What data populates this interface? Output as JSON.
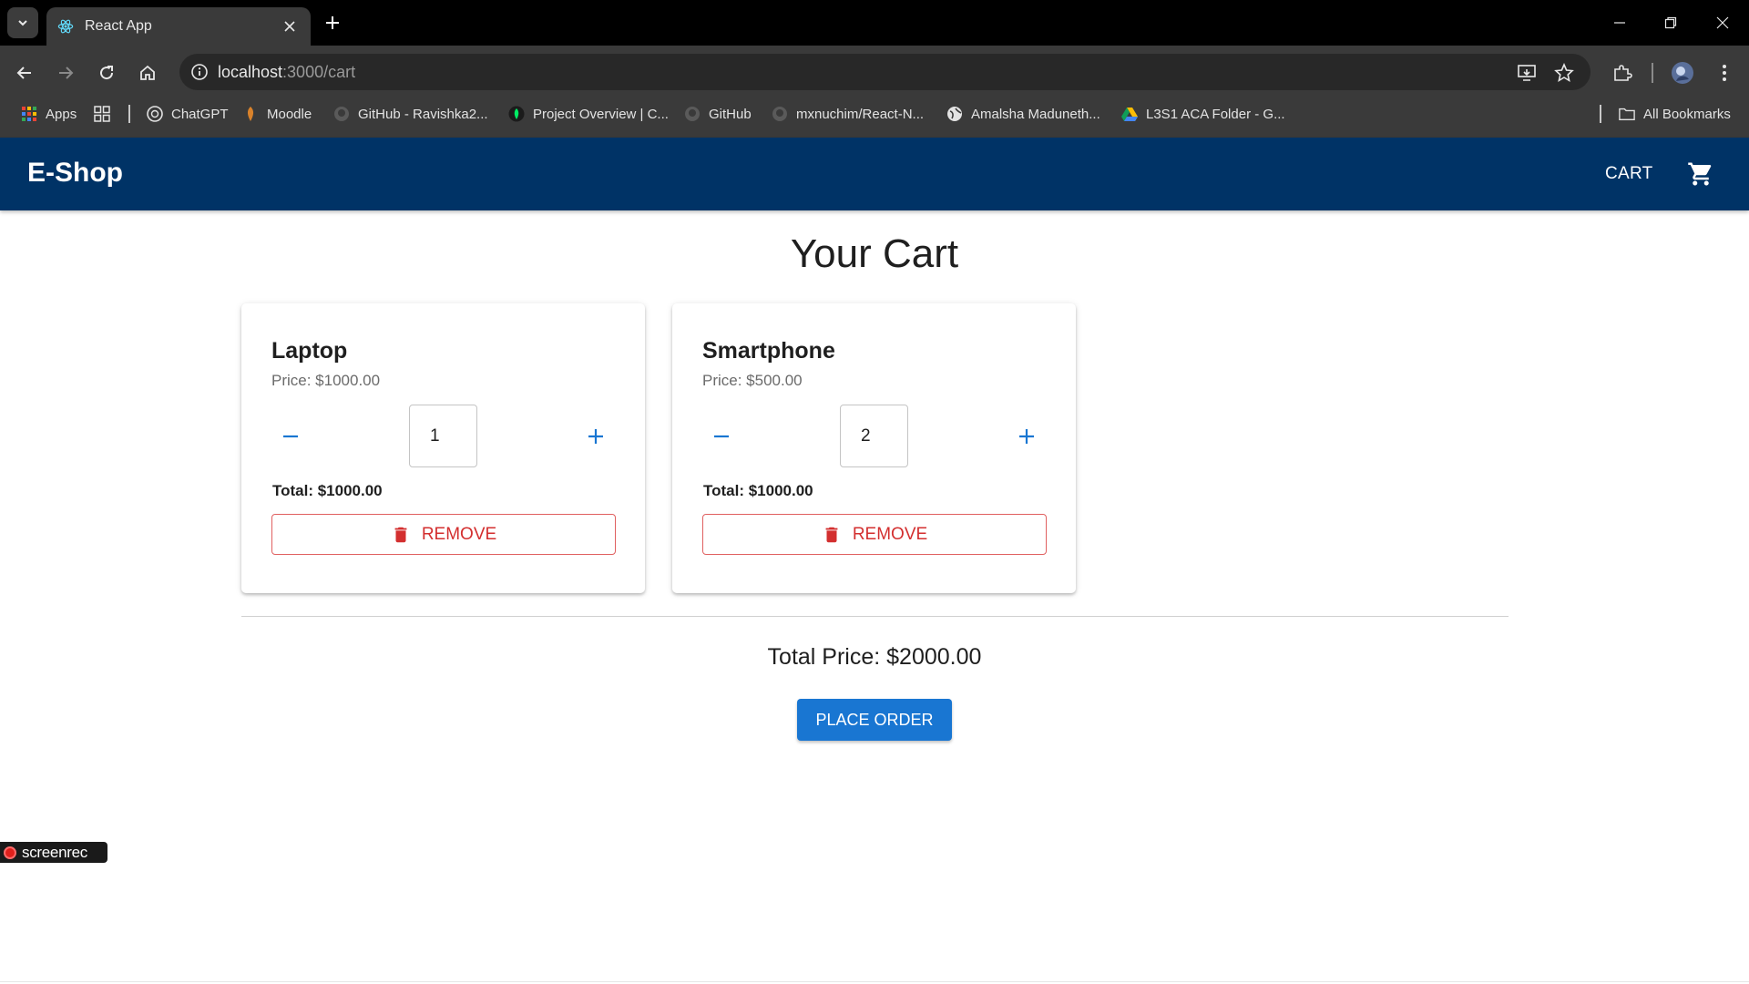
{
  "browser": {
    "tab_title": "React App",
    "url_host": "localhost",
    "url_path": ":3000/cart",
    "bookmarks": [
      {
        "label": "Apps",
        "icon": "apps-grid-icon"
      },
      {
        "label": "ChatGPT",
        "icon": "chatgpt-icon"
      },
      {
        "label": "Moodle",
        "icon": "moodle-icon"
      },
      {
        "label": "GitHub - Ravishka2...",
        "icon": "github-icon"
      },
      {
        "label": "Project Overview | C...",
        "icon": "mongodb-leaf-icon"
      },
      {
        "label": "GitHub",
        "icon": "github-icon"
      },
      {
        "label": "mxnuchim/React-N...",
        "icon": "github-icon"
      },
      {
        "label": "Amalsha Maduneth...",
        "icon": "globe-icon"
      },
      {
        "label": "L3S1 ACA Folder - G...",
        "icon": "google-drive-icon"
      }
    ],
    "all_bookmarks": "All Bookmarks"
  },
  "app": {
    "brand": "E-Shop",
    "cart_label": "CART",
    "page_title": "Your Cart",
    "items": [
      {
        "name": "Laptop",
        "price": "Price: $1000.00",
        "quantity": "1",
        "total": "Total: $1000.00",
        "remove_label": "REMOVE"
      },
      {
        "name": "Smartphone",
        "price": "Price: $500.00",
        "quantity": "2",
        "total": "Total: $1000.00",
        "remove_label": "REMOVE"
      }
    ],
    "grand_total": "Total Price: $2000.00",
    "place_order_label": "PLACE ORDER"
  },
  "overlay": {
    "screenrec_label": "screenrec"
  },
  "colors": {
    "appbar": "#003366",
    "primary": "#1976d2",
    "danger": "#d32f2f"
  }
}
